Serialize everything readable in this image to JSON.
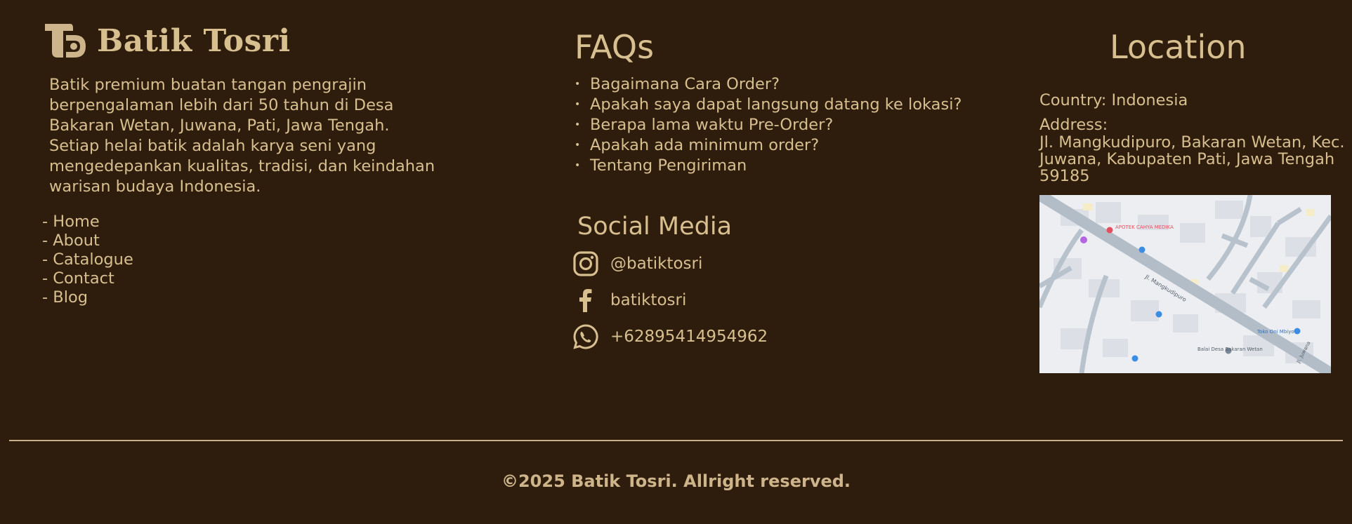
{
  "colors": {
    "background": "#2e1c0d",
    "text": "#d7bf8f",
    "divider": "#c8b18a"
  },
  "brand": {
    "name": "Batik Tosri",
    "logo_icon": "batik-tosri-logo"
  },
  "about": {
    "text": "Batik premium buatan tangan pengrajin berpengalaman lebih dari 50 tahun di Desa Bakaran Wetan, Juwana, Pati, Jawa Tengah. Setiap helai batik adalah karya seni yang mengedepankan kualitas, tradisi, dan keindahan warisan budaya Indonesia."
  },
  "nav": {
    "items": [
      "- Home",
      "- About",
      "- Catalogue",
      "- Contact",
      "- Blog"
    ]
  },
  "faq": {
    "title": "FAQs",
    "bullet": "•",
    "items": [
      "Bagaimana Cara Order?",
      "Apakah saya dapat langsung datang ke lokasi?",
      "Berapa lama waktu Pre-Order?",
      "Apakah ada minimum order?",
      "Tentang Pengiriman"
    ]
  },
  "social": {
    "title": "Social Media",
    "items": [
      {
        "icon": "instagram-icon",
        "label": "@batiktosri"
      },
      {
        "icon": "facebook-icon",
        "label": "batiktosri"
      },
      {
        "icon": "whatsapp-icon",
        "label": "+62895414954962"
      }
    ]
  },
  "location": {
    "title": "Location",
    "country": "Country: Indonesia",
    "address_label": "Address:",
    "address": "Jl. Mangkudipuro, Bakaran Wetan, Kec. Juwana, Kabupaten Pati, Jawa Tengah 59185",
    "map": {
      "icon": "map-embed",
      "labels": [
        "APOTEK CAHYA MEDIKA",
        "Jl. Mangkudipuro",
        "Balai Desa Bakaran Wetan",
        "Toko Oni Mbiyo",
        "Jl. Juwana"
      ]
    }
  },
  "footer": {
    "copyright": "©2025 Batik Tosri. Allright reserved."
  }
}
